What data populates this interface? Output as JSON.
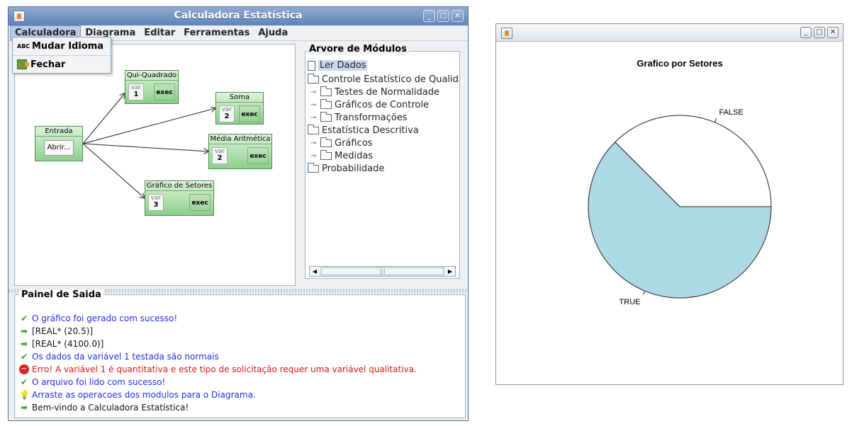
{
  "main_window": {
    "title": "Calculadora Estatística",
    "menus": [
      "Calculadora",
      "Diagrama",
      "Editar",
      "Ferramentas",
      "Ajuda"
    ],
    "active_menu": "Calculadora",
    "dropdown": [
      {
        "label": "Mudar Idioma",
        "icon": "abc-icon",
        "icon_text": "ABC"
      },
      {
        "label": "Fechar",
        "icon": "exit-icon"
      }
    ]
  },
  "diagram": {
    "modules": {
      "entrada": {
        "title": "Entrada",
        "button": "Abrir..."
      },
      "qui": {
        "title": "Qui-Quadrado",
        "var_label": "var",
        "var_value": "1",
        "exec": "exec"
      },
      "soma": {
        "title": "Soma",
        "var_label": "var",
        "var_value": "2",
        "exec": "exec"
      },
      "media": {
        "title": "Média Aritmética",
        "var_label": "var",
        "var_value": "2",
        "exec": "exec"
      },
      "setores": {
        "title": "Gráfico de Setores",
        "var_label": "var",
        "var_value": "3",
        "exec": "exec"
      }
    }
  },
  "tree": {
    "title": "Arvore de Módulos",
    "nodes": [
      {
        "label": "Ler Dados",
        "icon": "document-icon",
        "selected": true
      },
      {
        "label": "Controle Estatístico de Qualidad",
        "icon": "folder-icon"
      },
      {
        "label": "Testes de Normalidade",
        "icon": "folder-icon"
      },
      {
        "label": "Gráficos de Controle",
        "icon": "folder-icon"
      },
      {
        "label": "Transformações",
        "icon": "folder-icon"
      },
      {
        "label": "Estatística Descritiva",
        "icon": "folder-icon"
      },
      {
        "label": "Gráficos",
        "icon": "folder-icon"
      },
      {
        "label": "Medidas",
        "icon": "folder-icon"
      },
      {
        "label": "Probabilidade",
        "icon": "folder-icon"
      }
    ]
  },
  "output": {
    "title": "Painel de Saida",
    "lines": [
      {
        "text": "O gráfico foi gerado com sucesso!",
        "icon": "check-icon",
        "color": "#1f2ee6"
      },
      {
        "text": "[REAL* (20.5)]",
        "icon": "arrow-icon",
        "color": "#111111"
      },
      {
        "text": "[REAL* (4100.0)]",
        "icon": "arrow-icon",
        "color": "#111111"
      },
      {
        "text": "Os dados da variável 1 testada são normais",
        "icon": "check-icon",
        "color": "#1f2ee6"
      },
      {
        "text": "Erro! A variável 1 é quantitativa e este tipo de solicitação requer uma variável qualitativa.",
        "icon": "error-icon",
        "color": "#e01515"
      },
      {
        "text": "O arquivo foi lido com sucesso!",
        "icon": "check-icon",
        "color": "#1f2ee6"
      },
      {
        "text": "Arraste as operacoes dos modulos para o Diagrama.",
        "icon": "lightbulb-icon",
        "color": "#1f2ee6"
      },
      {
        "text": "Bem-vindo a Calculadora Estatística!",
        "icon": "arrow-icon",
        "color": "#111111"
      }
    ]
  },
  "chart_window": {
    "title": ""
  },
  "chart_data": {
    "type": "pie",
    "title": "Grafico por Setores",
    "slices": [
      {
        "label": "FALSE",
        "value": 0.375,
        "color": "#ffffff"
      },
      {
        "label": "TRUE",
        "value": 0.625,
        "color": "#add8e6"
      }
    ]
  }
}
